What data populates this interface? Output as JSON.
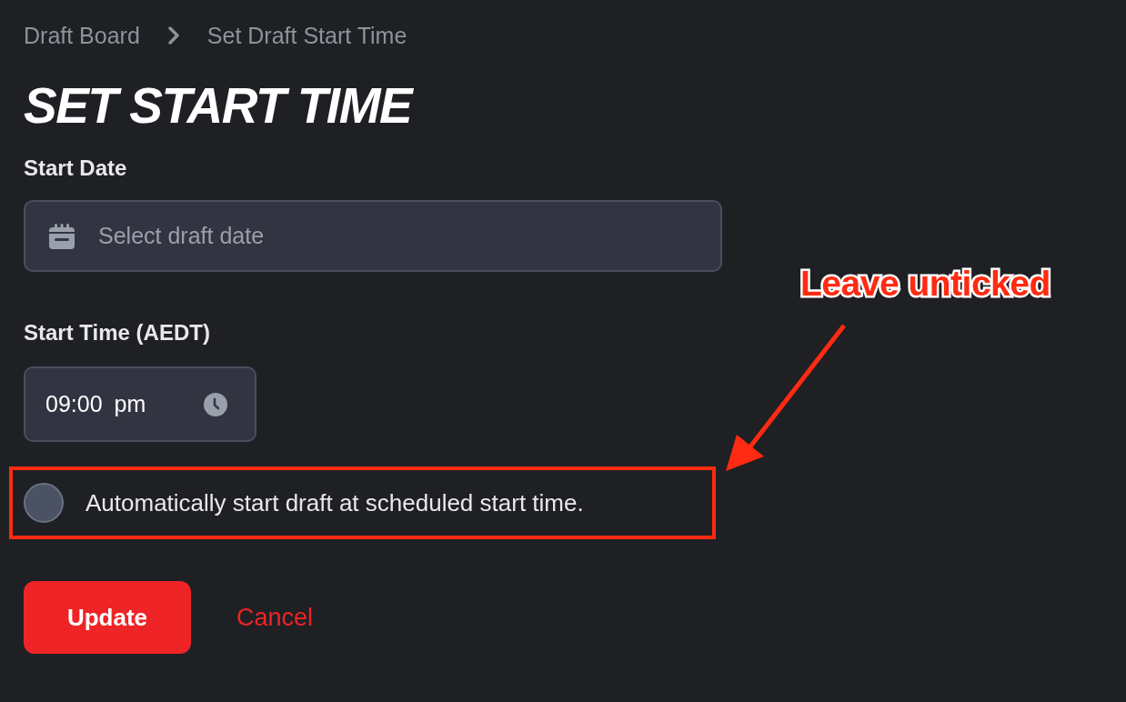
{
  "breadcrumb": [
    {
      "label": "Draft Board"
    },
    {
      "label": "Set Draft Start Time"
    }
  ],
  "title": "SET START TIME",
  "fields": [
    {
      "kind": "date",
      "label": "Start Date",
      "placeholder": "Select draft date"
    },
    {
      "kind": "time",
      "label": "Start Time (AEDT)",
      "value": "09:00 pm"
    }
  ],
  "auto_start": {
    "label": "Automatically start draft at scheduled start time.",
    "checked": false,
    "highlighted": true
  },
  "buttons": [
    {
      "kind": "primary",
      "label": "Update"
    },
    {
      "kind": "link",
      "label": "Cancel"
    }
  ],
  "annotation": {
    "text": "Leave unticked"
  }
}
